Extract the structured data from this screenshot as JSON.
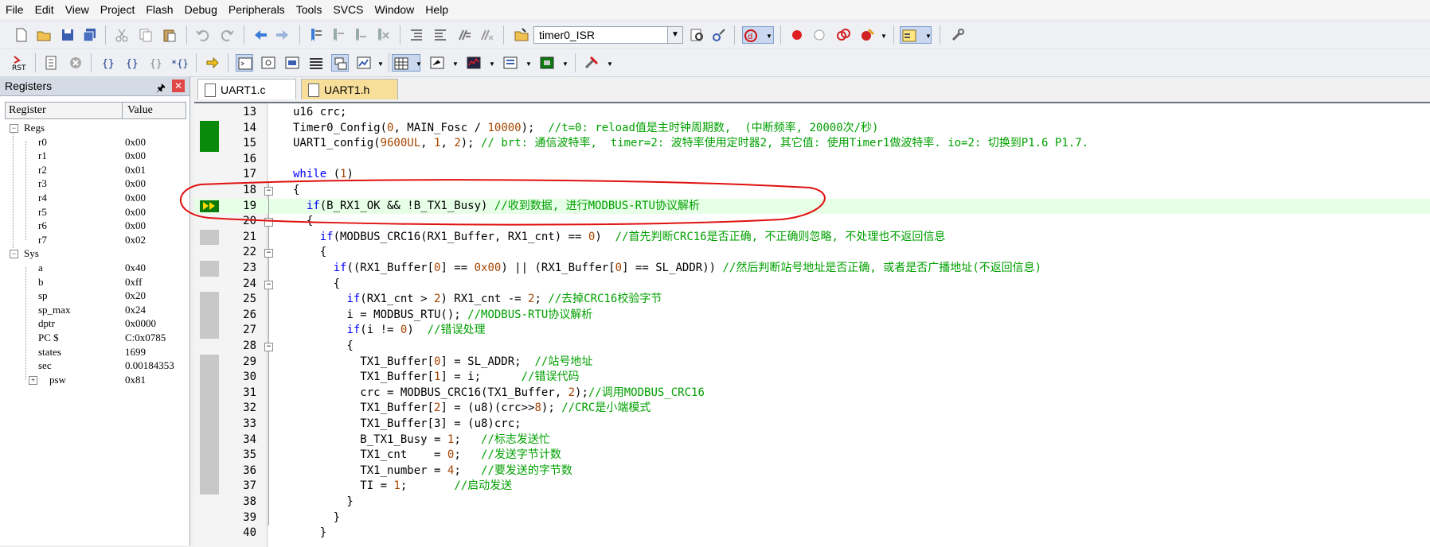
{
  "menu": [
    "File",
    "Edit",
    "View",
    "Project",
    "Flash",
    "Debug",
    "Peripherals",
    "Tools",
    "SVCS",
    "Window",
    "Help"
  ],
  "toolbar": {
    "target_combo": "timer0_ISR",
    "rst_label": "RST"
  },
  "registers_panel": {
    "title": "Registers",
    "columns": [
      "Register",
      "Value"
    ],
    "groups": [
      {
        "name": "Regs",
        "items": [
          {
            "name": "r0",
            "value": "0x00"
          },
          {
            "name": "r1",
            "value": "0x00"
          },
          {
            "name": "r2",
            "value": "0x01"
          },
          {
            "name": "r3",
            "value": "0x00"
          },
          {
            "name": "r4",
            "value": "0x00"
          },
          {
            "name": "r5",
            "value": "0x00"
          },
          {
            "name": "r6",
            "value": "0x00"
          },
          {
            "name": "r7",
            "value": "0x02"
          }
        ]
      },
      {
        "name": "Sys",
        "items": [
          {
            "name": "a",
            "value": "0x40"
          },
          {
            "name": "b",
            "value": "0xff"
          },
          {
            "name": "sp",
            "value": "0x20"
          },
          {
            "name": "sp_max",
            "value": "0x24"
          },
          {
            "name": "dptr",
            "value": "0x0000"
          },
          {
            "name": "PC  $",
            "value": "C:0x0785"
          },
          {
            "name": "states",
            "value": "1699"
          },
          {
            "name": "sec",
            "value": "0.00184353"
          },
          {
            "name": "psw",
            "value": "0x81"
          }
        ]
      }
    ]
  },
  "tabs": [
    {
      "label": "UART1.c",
      "active": true
    },
    {
      "label": "UART1.h",
      "active": false
    }
  ],
  "editor": {
    "current_line": "19",
    "lines": [
      {
        "n": "13",
        "text": "u16 crc;",
        "comment": ""
      },
      {
        "n": "14",
        "text": "Timer0_Config(0, MAIN_Fosc / 10000);  ",
        "comment": "//t=0: reload值是主时钟周期数,  (中断频率, 20000次/秒)"
      },
      {
        "n": "15",
        "text": "UART1_config(9600UL, 1, 2); ",
        "comment": "// brt: 通信波特率,  timer=2: 波特率使用定时器2, 其它值: 使用Timer1做波特率. io=2: 切换到P1.6 P1.7."
      },
      {
        "n": "16",
        "text": "",
        "comment": ""
      },
      {
        "n": "17",
        "text": "while (1)",
        "comment": ""
      },
      {
        "n": "18",
        "text": "{",
        "comment": ""
      },
      {
        "n": "19",
        "text": "  if(B_RX1_OK && !B_TX1_Busy) ",
        "comment": "//收到数据, 进行MODBUS-RTU协议解析"
      },
      {
        "n": "20",
        "text": "  {",
        "comment": ""
      },
      {
        "n": "21",
        "text": "    if(MODBUS_CRC16(RX1_Buffer, RX1_cnt) == 0)  ",
        "comment": "//首先判断CRC16是否正确, 不正确则忽略, 不处理也不返回信息"
      },
      {
        "n": "22",
        "text": "    {",
        "comment": ""
      },
      {
        "n": "23",
        "text": "      if((RX1_Buffer[0] == 0x00) || (RX1_Buffer[0] == SL_ADDR)) ",
        "comment": "//然后判断站号地址是否正确, 或者是否广播地址(不返回信息)"
      },
      {
        "n": "24",
        "text": "      {",
        "comment": ""
      },
      {
        "n": "25",
        "text": "        if(RX1_cnt > 2) RX1_cnt -= 2; ",
        "comment": "//去掉CRC16校验字节"
      },
      {
        "n": "26",
        "text": "        i = MODBUS_RTU(); ",
        "comment": "//MODBUS-RTU协议解析"
      },
      {
        "n": "27",
        "text": "        if(i != 0)  ",
        "comment": "//错误处理"
      },
      {
        "n": "28",
        "text": "        {",
        "comment": ""
      },
      {
        "n": "29",
        "text": "          TX1_Buffer[0] = SL_ADDR;  ",
        "comment": "//站号地址"
      },
      {
        "n": "30",
        "text": "          TX1_Buffer[1] = i;      ",
        "comment": "//错误代码"
      },
      {
        "n": "31",
        "text": "          crc = MODBUS_CRC16(TX1_Buffer, 2);",
        "comment": "//调用MODBUS_CRC16"
      },
      {
        "n": "32",
        "text": "          TX1_Buffer[2] = (u8)(crc>>8); ",
        "comment": "//CRC是小端模式"
      },
      {
        "n": "33",
        "text": "          TX1_Buffer[3] = (u8)crc;",
        "comment": ""
      },
      {
        "n": "34",
        "text": "          B_TX1_Busy = 1;   ",
        "comment": "//标志发送忙"
      },
      {
        "n": "35",
        "text": "          TX1_cnt    = 0;   ",
        "comment": "//发送字节计数"
      },
      {
        "n": "36",
        "text": "          TX1_number = 4;   ",
        "comment": "//要发送的字节数"
      },
      {
        "n": "37",
        "text": "          TI = 1;       ",
        "comment": "//启动发送"
      },
      {
        "n": "38",
        "text": "        }",
        "comment": ""
      },
      {
        "n": "39",
        "text": "      }",
        "comment": ""
      },
      {
        "n": "40",
        "text": "    }",
        "comment": ""
      }
    ]
  },
  "colors": {
    "keyword": "#0000ff",
    "comment": "#00a000",
    "number": "#a64400",
    "annotation": "#e01010"
  }
}
